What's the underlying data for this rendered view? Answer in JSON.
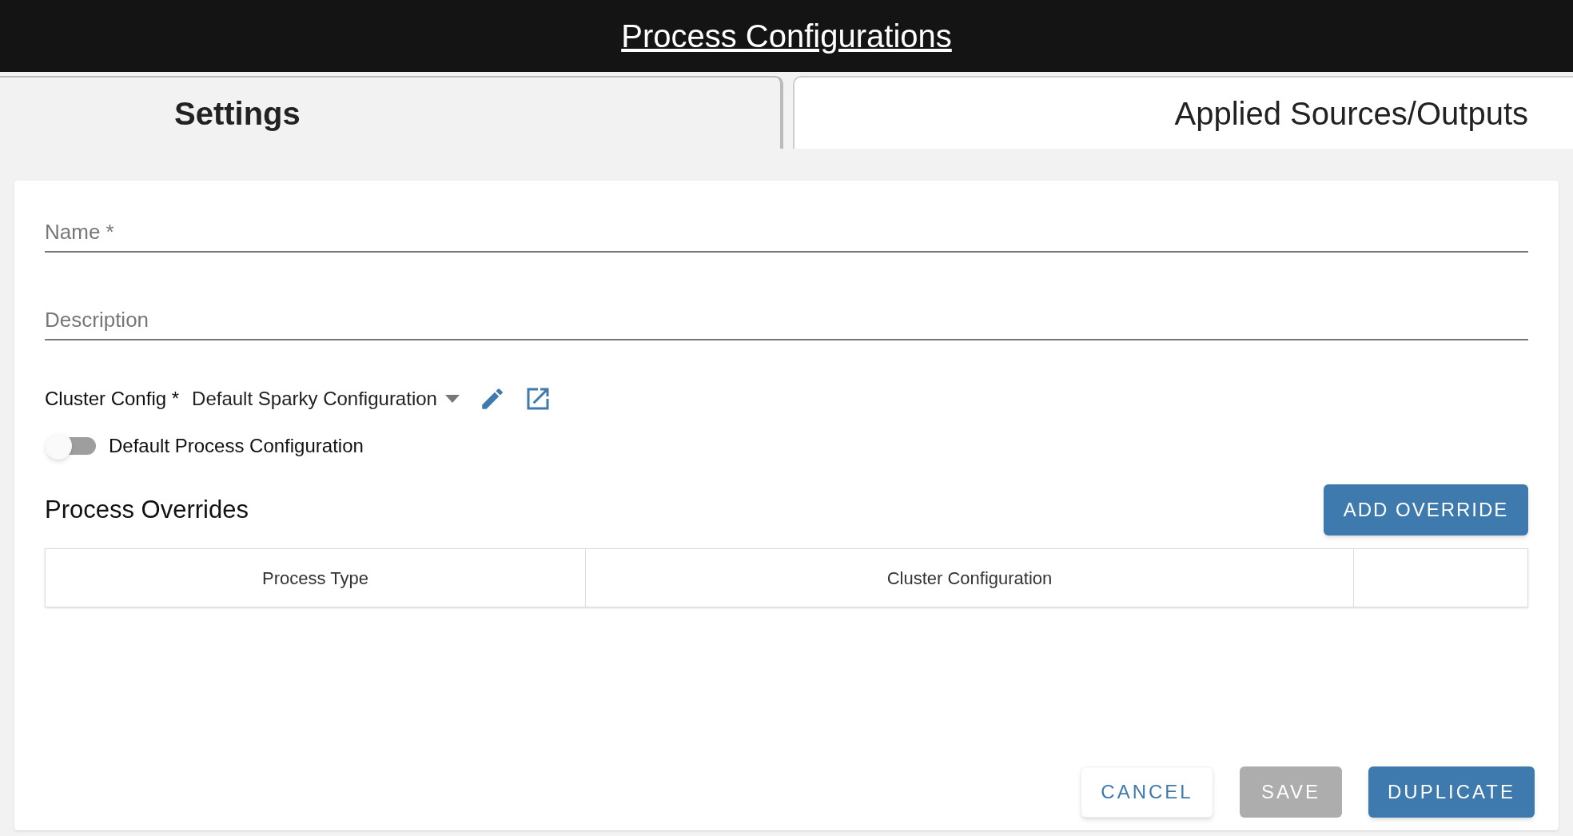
{
  "header": {
    "title": "Process Configurations"
  },
  "tabs": [
    {
      "label": "Settings",
      "selected": true
    },
    {
      "label": "Applied Sources/Outputs",
      "selected": false
    }
  ],
  "form": {
    "name": {
      "placeholder": "Name *"
    },
    "description": {
      "placeholder": "Description"
    },
    "cluster_config": {
      "label": "Cluster Config *",
      "value": "Default Sparky Configuration"
    },
    "default_toggle": {
      "label": "Default Process Configuration",
      "on": false
    }
  },
  "overrides": {
    "title": "Process Overrides",
    "add_button": "ADD OVERRIDE",
    "columns": [
      "Process Type",
      "Cluster Configuration",
      ""
    ]
  },
  "buttons": [
    {
      "label": "CANCEL",
      "kind": "outlined",
      "disabled": false
    },
    {
      "label": "SAVE",
      "kind": "contained",
      "disabled": true
    },
    {
      "label": "DUPLICATE",
      "kind": "contained",
      "disabled": false
    }
  ]
}
